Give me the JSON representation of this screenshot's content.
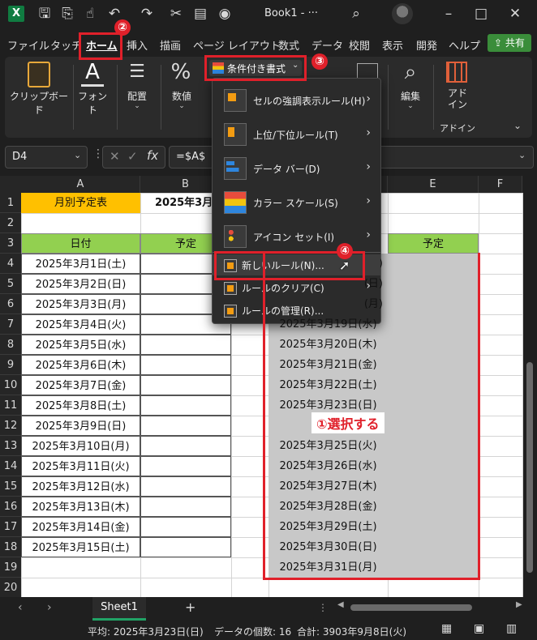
{
  "titlebar": {
    "doc_title": "Book1 - ···",
    "icons": [
      "excel-logo",
      "save-icon",
      "autosave-icon",
      "touch-icon",
      "undo-icon",
      "redo-icon",
      "format-painter-icon",
      "clipboard-icon",
      "camera-icon",
      "search-icon"
    ],
    "window_controls": [
      "–",
      "□",
      "✕"
    ]
  },
  "menu": {
    "tabs": [
      "ファイル",
      "タッチ",
      "ホーム",
      "挿入",
      "描画",
      "ページ レイアウト",
      "数式",
      "データ",
      "校閲",
      "表示",
      "開発",
      "ヘルプ"
    ],
    "share_label": "共有"
  },
  "ribbon": {
    "clipboard_label": "クリップボード",
    "font_label": "フォント",
    "align_label": "配置",
    "number_label": "数値",
    "cf_label": "条件付き書式",
    "edit_label": "編集",
    "addin_label": "アド\nイン",
    "addin_group_label": "アドイン"
  },
  "formula_bar": {
    "name_box": "D4",
    "formula": "=$A$"
  },
  "columns": [
    "A",
    "B",
    "C",
    "D",
    "E",
    "F"
  ],
  "rows": [
    "1",
    "2",
    "3",
    "4",
    "5",
    "6",
    "7",
    "8",
    "9",
    "10",
    "11",
    "12",
    "13",
    "14",
    "15",
    "16",
    "17",
    "18",
    "19",
    "20"
  ],
  "sheet": {
    "a1": "月別予定表",
    "b1": "2025年3月",
    "a3": "日付",
    "b3": "予定",
    "e3": "予定",
    "col_a_dates": [
      "2025年3月1日(土)",
      "2025年3月2日(日)",
      "2025年3月3日(月)",
      "2025年3月4日(火)",
      "2025年3月5日(水)",
      "2025年3月6日(木)",
      "2025年3月7日(金)",
      "2025年3月8日(土)",
      "2025年3月9日(日)",
      "2025年3月10日(月)",
      "2025年3月11日(火)",
      "2025年3月12日(水)",
      "2025年3月13日(木)",
      "2025年3月14日(金)",
      "2025年3月15日(土)"
    ],
    "col_d_rows": [
      {
        "row": 4,
        "text": "(土)"
      },
      {
        "row": 5,
        "text": "(日)"
      },
      {
        "row": 6,
        "text": "(月)"
      },
      {
        "row": 7,
        "text": "2025年3月19日(水)"
      },
      {
        "row": 8,
        "text": "2025年3月20日(木)"
      },
      {
        "row": 9,
        "text": "2025年3月21日(金)"
      },
      {
        "row": 10,
        "text": "2025年3月22日(土)"
      },
      {
        "row": 11,
        "text": "2025年3月23日(日)"
      },
      {
        "row": 12,
        "text": "2025"
      },
      {
        "row": 13,
        "text": "2025年3月25日(火)"
      },
      {
        "row": 14,
        "text": "2025年3月26日(水)"
      },
      {
        "row": 15,
        "text": "2025年3月27日(木)"
      },
      {
        "row": 16,
        "text": "2025年3月28日(金)"
      },
      {
        "row": 17,
        "text": "2025年3月29日(土)"
      },
      {
        "row": 18,
        "text": "2025年3月30日(日)"
      },
      {
        "row": 19,
        "text": "2025年3月31日(月)"
      }
    ]
  },
  "cf_menu": {
    "items": [
      {
        "label": "セルの強調表示ルール(H)",
        "icon": "highlight-rules-icon",
        "submenu": true
      },
      {
        "label": "上位/下位ルール(T)",
        "icon": "top-bottom-icon",
        "submenu": true
      },
      {
        "label": "データ バー(D)",
        "icon": "data-bar-icon",
        "submenu": true
      },
      {
        "label": "カラー スケール(S)",
        "icon": "color-scale-icon",
        "submenu": true
      },
      {
        "label": "アイコン セット(I)",
        "icon": "icon-set-icon",
        "submenu": true
      }
    ],
    "small_items": [
      {
        "label": "新しいルール(N)...",
        "icon": "new-rule-icon",
        "submenu": false
      },
      {
        "label": "ルールのクリア(C)",
        "icon": "clear-rules-icon",
        "submenu": true
      },
      {
        "label": "ルールの管理(R)...",
        "icon": "manage-rules-icon",
        "submenu": false
      }
    ]
  },
  "annotations": {
    "badge1_text": "①選択する",
    "badge2": "②",
    "badge3": "③",
    "badge4": "④",
    "color": "#e0202a"
  },
  "sheet_tabs": {
    "active": "Sheet1",
    "add_label": "+"
  },
  "status": {
    "average": "平均: 2025年3月23日(日)",
    "count": "データの個数: 16",
    "sum": "合計: 3903年9月8日(火)"
  },
  "colors": {
    "header_orange": "#ffc000",
    "header_green": "#92d050",
    "selection_gray": "#c8c8c8",
    "excel_green": "#107c41"
  }
}
